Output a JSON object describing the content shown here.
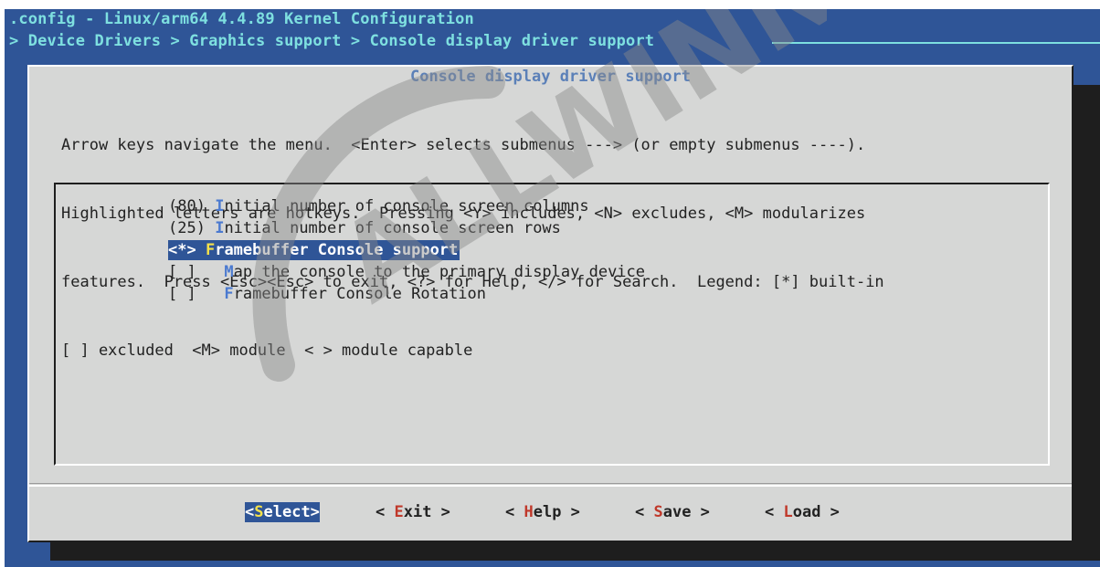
{
  "header": {
    "title": ".config - Linux/arm64 4.4.89 Kernel Configuration",
    "breadcrumb": "> Device Drivers > Graphics support > Console display driver support"
  },
  "dialog": {
    "title": "Console display driver support",
    "help_lines": [
      "Arrow keys navigate the menu.  <Enter> selects submenus ---> (or empty submenus ----).",
      "Highlighted letters are hotkeys.  Pressing <Y> includes, <N> excludes, <M> modularizes",
      "features.  Press <Esc><Esc> to exit, <?> for Help, </> for Search.  Legend: [*] built-in",
      "[ ] excluded  <M> module  < > module capable"
    ]
  },
  "menu": {
    "items": [
      {
        "prefix": "(80) ",
        "hotkey": "I",
        "rest": "nitial number of console screen columns"
      },
      {
        "prefix": "(25) ",
        "hotkey": "I",
        "rest": "nitial number of console screen rows"
      },
      {
        "prefix": "<*> ",
        "hotkey": "F",
        "rest": "ramebuffer Console support"
      },
      {
        "prefix": "[ ]   ",
        "hotkey": "M",
        "rest": "ap the console to the primary display device"
      },
      {
        "prefix": "[ ]   ",
        "hotkey": "F",
        "rest": "ramebuffer Console Rotation"
      }
    ],
    "selected_index": 2
  },
  "buttons": {
    "select": {
      "pre": "<",
      "hk": "S",
      "post": "elect>"
    },
    "exit": {
      "pre": "< ",
      "hk": "E",
      "post": "xit >"
    },
    "help": {
      "pre": "< ",
      "hk": "H",
      "post": "elp >"
    },
    "save": {
      "pre": "< ",
      "hk": "S",
      "post": "ave >"
    },
    "load": {
      "pre": "< ",
      "hk": "L",
      "post": "oad >"
    }
  },
  "watermark": {
    "text": "ALLWINNER"
  },
  "colors": {
    "terminal_bg": "#2f5597",
    "dialog_bg": "#d6d7d6",
    "header_text": "#7ee0e0",
    "hotkey": "#4b7ad0",
    "button_hotkey": "#c0392b",
    "selected_hotkey": "#f6e24a"
  }
}
